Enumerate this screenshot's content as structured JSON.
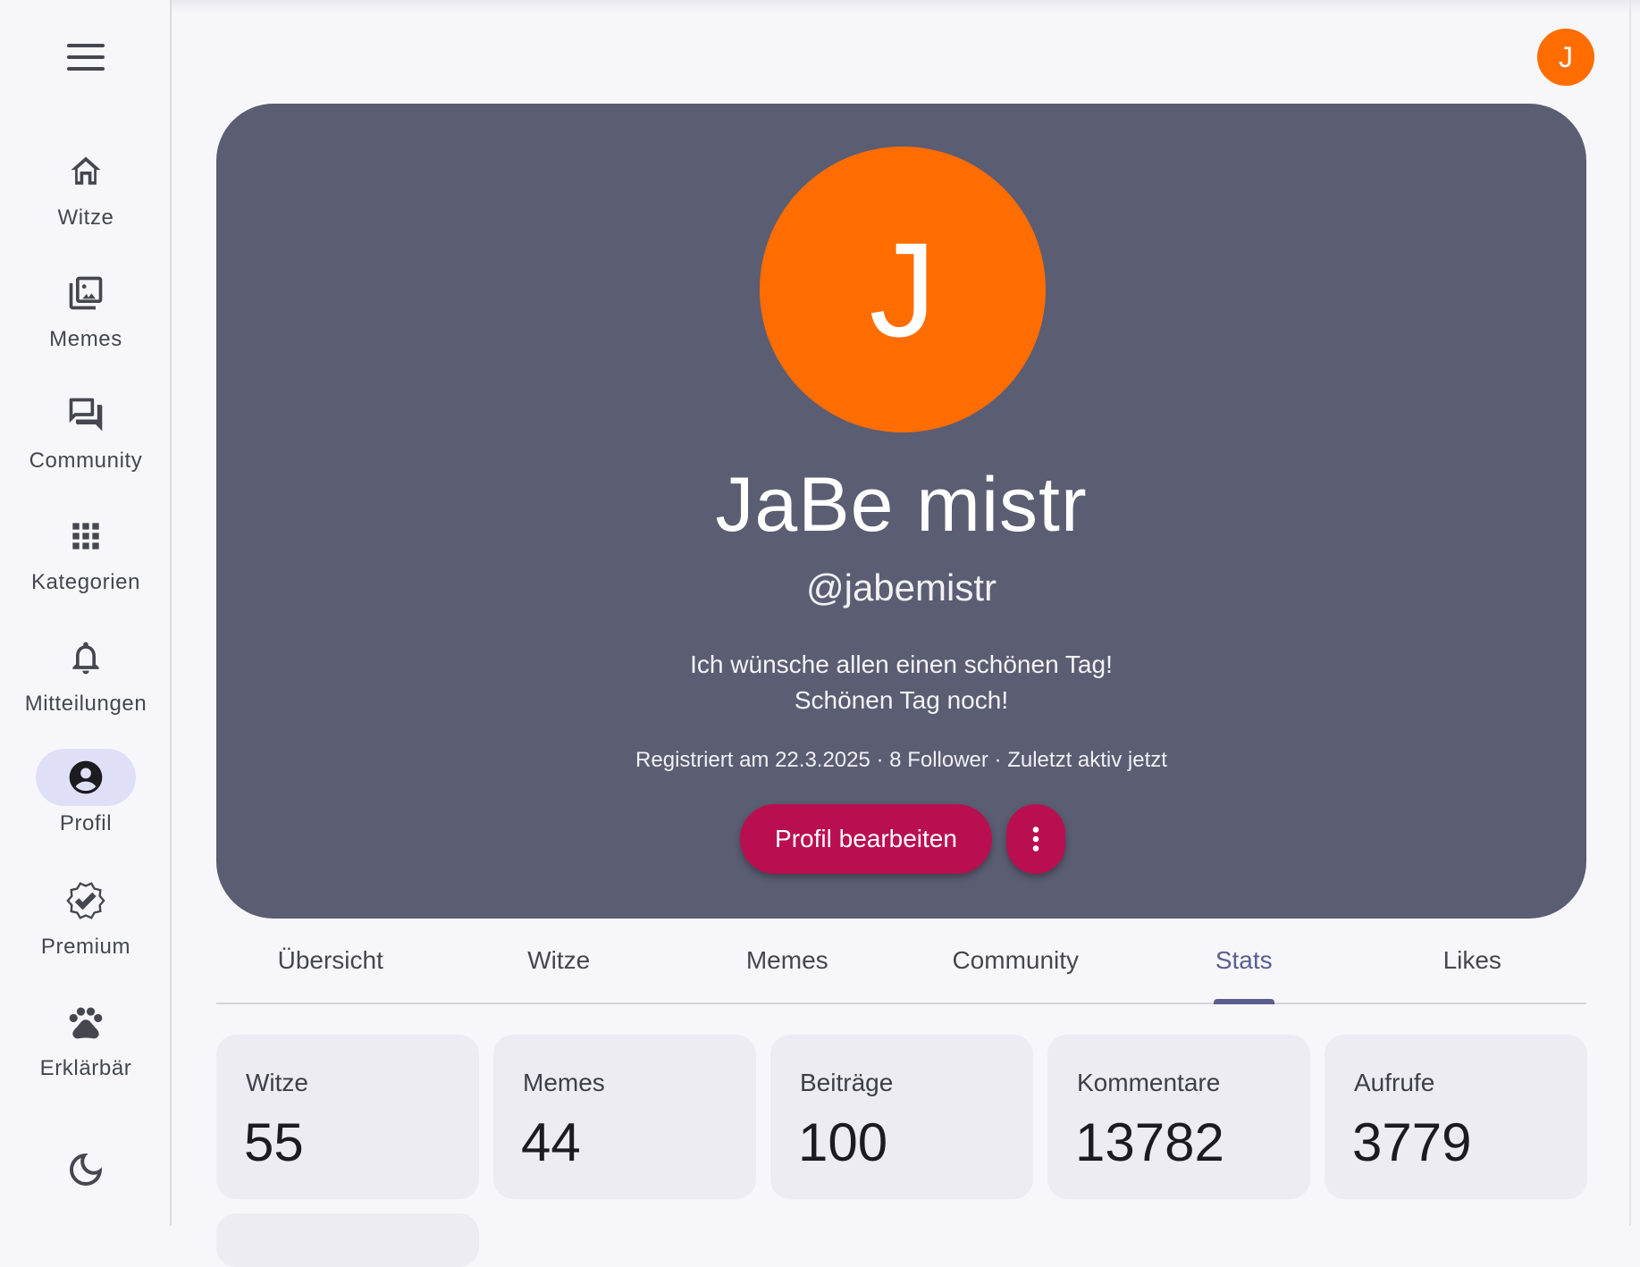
{
  "sidebar": {
    "menu_icon": "hamburger-menu-icon",
    "items": [
      {
        "label": "Witze",
        "icon": "home-icon"
      },
      {
        "label": "Memes",
        "icon": "photo-library-icon"
      },
      {
        "label": "Community",
        "icon": "forum-icon"
      },
      {
        "label": "Kategorien",
        "icon": "apps-grid-icon"
      },
      {
        "label": "Mitteilungen",
        "icon": "bell-icon"
      },
      {
        "label": "Profil",
        "icon": "account-circle-icon",
        "active": true
      },
      {
        "label": "Premium",
        "icon": "verified-badge-icon"
      },
      {
        "label": "Erklärbär",
        "icon": "paw-icon"
      }
    ],
    "theme_icon": "moon-icon"
  },
  "header": {
    "avatar_initial": "J"
  },
  "profile": {
    "avatar_initial": "J",
    "display_name": "JaBe mistr",
    "username": "@jabemistr",
    "bio_line1": "Ich wünsche allen einen schönen Tag!",
    "bio_line2": "Schönen Tag noch!",
    "meta": "Registriert am 22.3.2025 · 8 Follower · Zuletzt aktiv jetzt",
    "edit_button": "Profil bearbeiten",
    "more_icon": "more-vertical-icon"
  },
  "tabs": [
    {
      "label": "Übersicht"
    },
    {
      "label": "Witze"
    },
    {
      "label": "Memes"
    },
    {
      "label": "Community"
    },
    {
      "label": "Stats",
      "active": true
    },
    {
      "label": "Likes"
    }
  ],
  "stats": [
    {
      "label": "Witze",
      "value": "55"
    },
    {
      "label": "Memes",
      "value": "44"
    },
    {
      "label": "Beiträge",
      "value": "100"
    },
    {
      "label": "Kommentare",
      "value": "13782"
    },
    {
      "label": "Aufrufe",
      "value": "3779"
    }
  ],
  "colors": {
    "accent": "#b90f50",
    "avatar": "#ff6d00",
    "card": "#5b5d72",
    "active_nav": "#dfe0f8"
  }
}
